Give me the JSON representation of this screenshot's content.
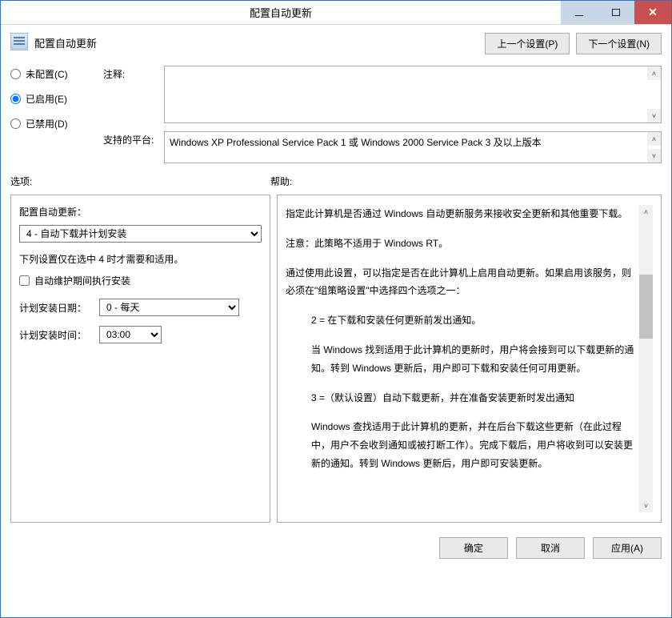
{
  "window": {
    "title": "配置自动更新"
  },
  "header": {
    "title": "配置自动更新",
    "prev": "上一个设置(P)",
    "next": "下一个设置(N)"
  },
  "radios": {
    "not_configured": "未配置(C)",
    "enabled": "已启用(E)",
    "disabled": "已禁用(D)"
  },
  "labels": {
    "comment": "注释:",
    "platform": "支持的平台:",
    "options": "选项:",
    "help": "帮助:"
  },
  "platform_text": "Windows XP Professional Service Pack 1 或 Windows 2000 Service Pack 3 及以上版本",
  "options": {
    "config_label": "配置自动更新：",
    "config_value": "4 - 自动下载并计划安装",
    "note": "下列设置仅在选中 4 时才需要和适用。",
    "checkbox": "自动维护期间执行安装",
    "date_label": "计划安装日期：",
    "date_value": "0 - 每天",
    "time_label": "计划安装时间：",
    "time_value": "03:00"
  },
  "help": {
    "p1": "指定此计算机是否通过 Windows 自动更新服务来接收安全更新和其他重要下载。",
    "p2": "注意：此策略不适用于 Windows RT。",
    "p3": "通过使用此设置，可以指定是否在此计算机上启用自动更新。如果启用该服务，则必须在\"组策略设置\"中选择四个选项之一：",
    "p4": "2 = 在下载和安装任何更新前发出通知。",
    "p5": "当 Windows 找到适用于此计算机的更新时，用户将会接到可以下载更新的通知。转到 Windows 更新后，用户即可下载和安装任何可用更新。",
    "p6": "3 =（默认设置）自动下载更新，并在准备安装更新时发出通知",
    "p7": "Windows 查找适用于此计算机的更新，并在后台下载这些更新（在此过程中，用户不会收到通知或被打断工作）。完成下载后，用户将收到可以安装更新的通知。转到 Windows 更新后，用户即可安装更新。"
  },
  "footer": {
    "ok": "确定",
    "cancel": "取消",
    "apply": "应用(A)"
  }
}
